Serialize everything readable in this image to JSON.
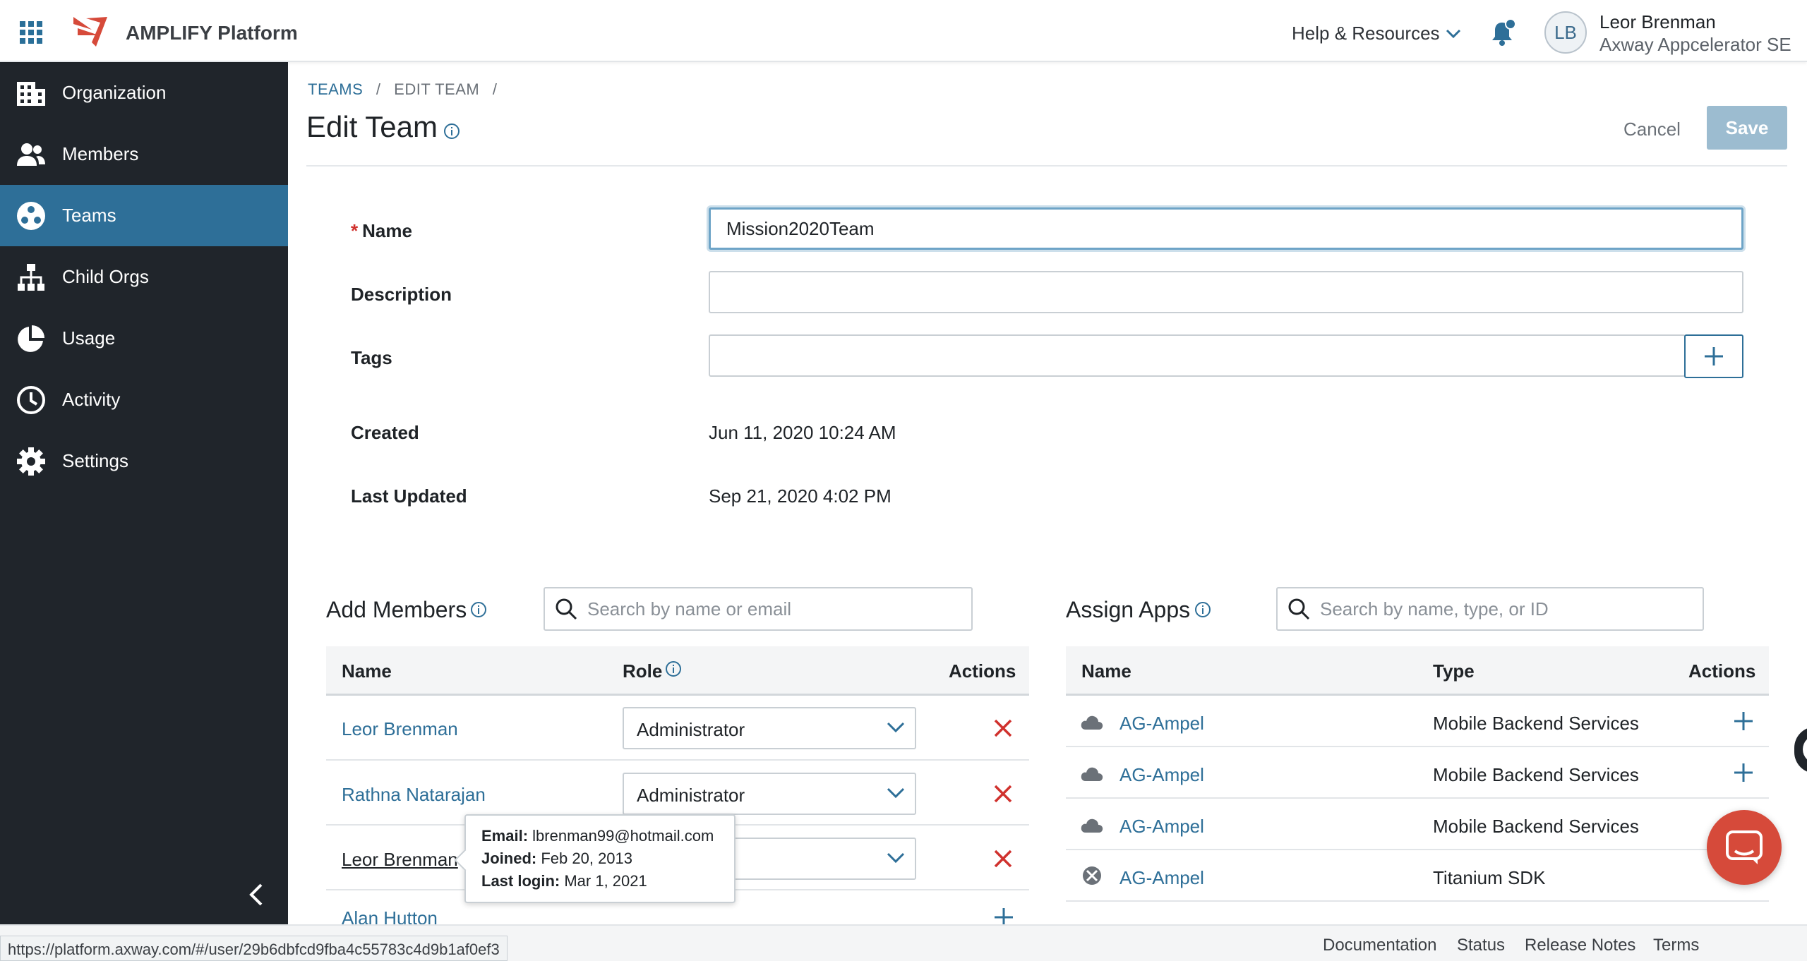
{
  "header": {
    "brand": "AMPLIFY Platform",
    "help_label": "Help & Resources",
    "user_initials": "LB",
    "user_name": "Leor Brenman",
    "user_org": "Axway Appcelerator SE"
  },
  "sidebar": {
    "items": [
      {
        "label": "Organization",
        "icon": "building-icon"
      },
      {
        "label": "Members",
        "icon": "people-icon"
      },
      {
        "label": "Teams",
        "icon": "teams-icon",
        "active": true
      },
      {
        "label": "Child Orgs",
        "icon": "hierarchy-icon"
      },
      {
        "label": "Usage",
        "icon": "pie-chart-icon"
      },
      {
        "label": "Activity",
        "icon": "clock-icon"
      },
      {
        "label": "Settings",
        "icon": "gear-icon"
      }
    ]
  },
  "breadcrumb": {
    "teams": "TEAMS",
    "sep1": "/",
    "edit": "EDIT TEAM",
    "sep2": "/"
  },
  "page": {
    "title": "Edit Team",
    "cancel_label": "Cancel",
    "save_label": "Save"
  },
  "form": {
    "name_label": "Name",
    "name_required_mark": "*",
    "name_value": "Mission2020Team",
    "description_label": "Description",
    "description_value": "",
    "tags_label": "Tags",
    "tags_value": "",
    "created_label": "Created",
    "created_value": "Jun 11, 2020 10:24 AM",
    "updated_label": "Last Updated",
    "updated_value": "Sep 21, 2020 4:02 PM"
  },
  "members": {
    "title": "Add Members",
    "search_placeholder": "Search by name or email",
    "col_name": "Name",
    "col_role": "Role",
    "col_actions": "Actions",
    "rows": [
      {
        "name": "Leor Brenman",
        "role": "Administrator"
      },
      {
        "name": "Rathna Natarajan",
        "role": "Administrator"
      },
      {
        "name": "Leor Brenman",
        "role": ""
      },
      {
        "name": "Alan Hutton",
        "role": ""
      }
    ],
    "tooltip": {
      "email_label": "Email:",
      "email": "lbrenman99@hotmail.com",
      "joined_label": "Joined:",
      "joined": "Feb 20, 2013",
      "last_login_label": "Last login:",
      "last_login": "Mar 1, 2021"
    }
  },
  "apps": {
    "title": "Assign Apps",
    "search_placeholder": "Search by name, type, or ID",
    "col_name": "Name",
    "col_type": "Type",
    "col_actions": "Actions",
    "rows": [
      {
        "name": "AG-Ampel",
        "type": "Mobile Backend Services",
        "icon": "cloud-icon"
      },
      {
        "name": "AG-Ampel",
        "type": "Mobile Backend Services",
        "icon": "cloud-icon"
      },
      {
        "name": "AG-Ampel",
        "type": "Mobile Backend Services",
        "icon": "cloud-icon"
      },
      {
        "name": "AG-Ampel",
        "type": "Titanium SDK",
        "icon": "titanium-icon"
      }
    ]
  },
  "status_url": "https://platform.axway.com/#/user/29b6dbfcd9fba4c55783c4d9b1af0ef3",
  "footer": {
    "documentation": "Documentation",
    "status": "Status",
    "release_notes": "Release Notes",
    "terms": "Terms"
  },
  "help_tab_glyph": "?",
  "colors": {
    "accent": "#2e6f98",
    "sidebar": "#20252b",
    "danger": "#d0312d",
    "save_disabled": "#9cbcd0",
    "chat": "#d64a3a"
  }
}
